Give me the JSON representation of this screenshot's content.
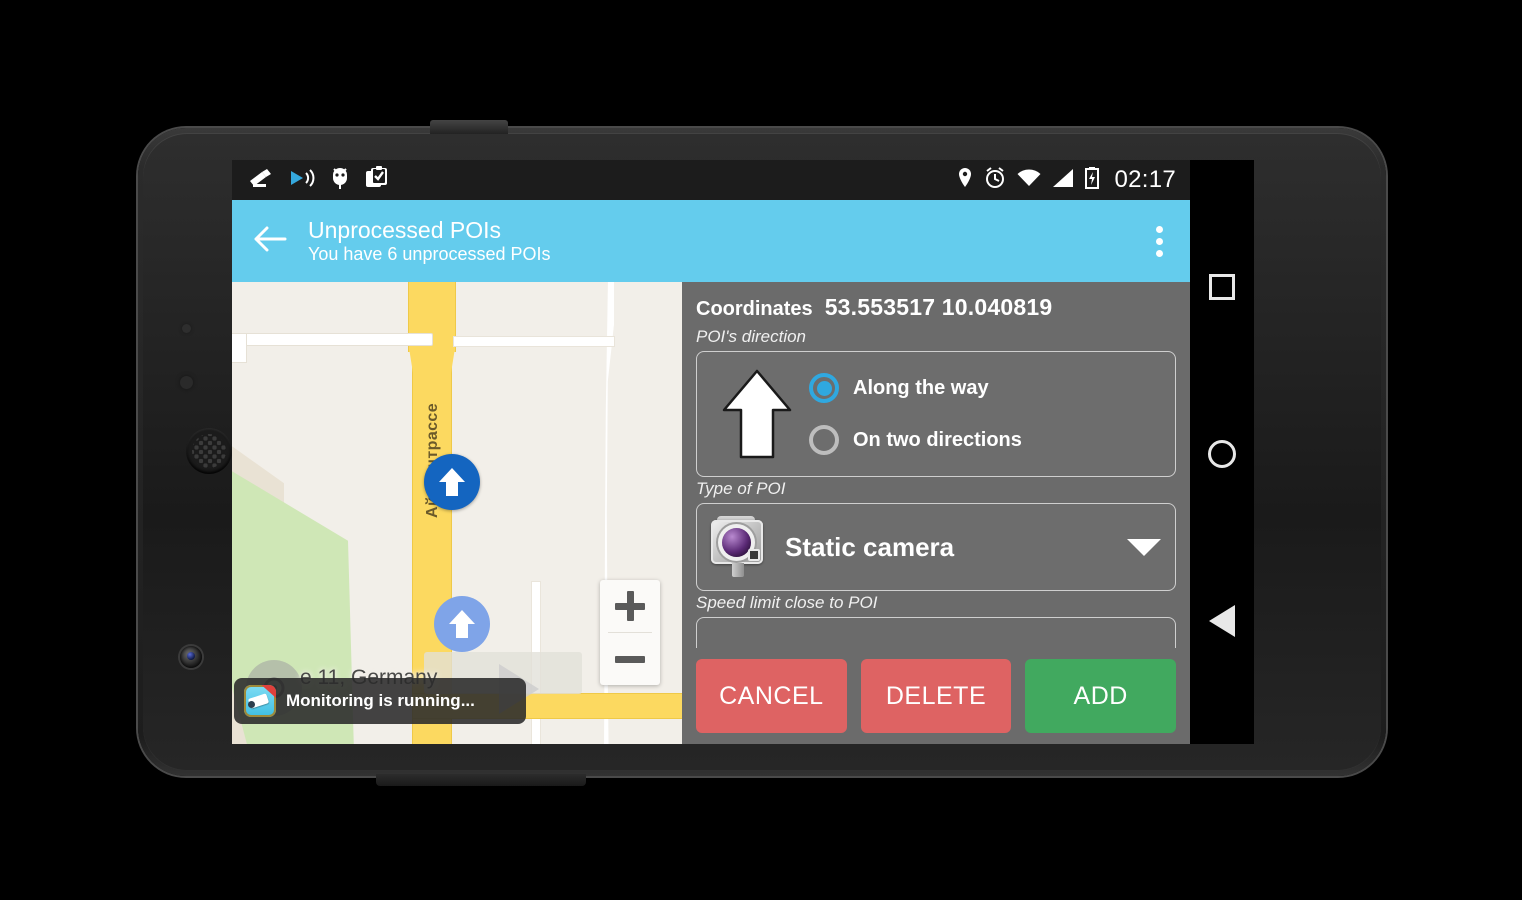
{
  "statusbar": {
    "icons_left": [
      "speed-camera-icon",
      "cast-play-icon",
      "android-head-icon",
      "clipboard-check-icon"
    ],
    "icons_right": [
      "location-pin-icon",
      "alarm-clock-icon",
      "wifi-icon",
      "signal-icon",
      "battery-charging-icon"
    ],
    "time": "02:17"
  },
  "appbar": {
    "back_icon": "back-arrow-icon",
    "title": "Unprocessed POIs",
    "subtitle": "You have 6 unprocessed POIs",
    "overflow_icon": "overflow-menu-icon",
    "color": "#64cced"
  },
  "map": {
    "street_label": "Айфештрассе",
    "address_label": "е 11, Germany",
    "markers": [
      {
        "name": "poi-marker-primary",
        "color": "#1465c0",
        "direction": "up"
      },
      {
        "name": "poi-marker-secondary",
        "color": "#7fa4e8",
        "direction": "up"
      }
    ],
    "zoom_in_label": "+",
    "zoom_out_label": "−",
    "toast": {
      "icon": "app-camera-icon",
      "text": "Monitoring is running..."
    }
  },
  "form": {
    "coordinates_label": "Coordinates",
    "coordinates_value": "53.553517  10.040819",
    "direction": {
      "label": "POI's direction",
      "arrow_icon": "direction-arrow-up-icon",
      "options": [
        {
          "label": "Along the way",
          "selected": true
        },
        {
          "label": "On two directions",
          "selected": false
        }
      ],
      "accent": "#2fa8e0"
    },
    "type": {
      "label": "Type of POI",
      "icon": "static-camera-icon",
      "value": "Static camera",
      "caret_icon": "chevron-down-icon"
    },
    "speed": {
      "label": "Speed limit close to POI",
      "value": ""
    },
    "buttons": [
      {
        "label": "CANCEL",
        "color": "#de6363"
      },
      {
        "label": "DELETE",
        "color": "#de6363"
      },
      {
        "label": "ADD",
        "color": "#41a95f"
      }
    ]
  },
  "navbar": {
    "recents_icon": "recents-square-icon",
    "home_icon": "home-circle-icon",
    "back_icon": "back-triangle-icon"
  }
}
